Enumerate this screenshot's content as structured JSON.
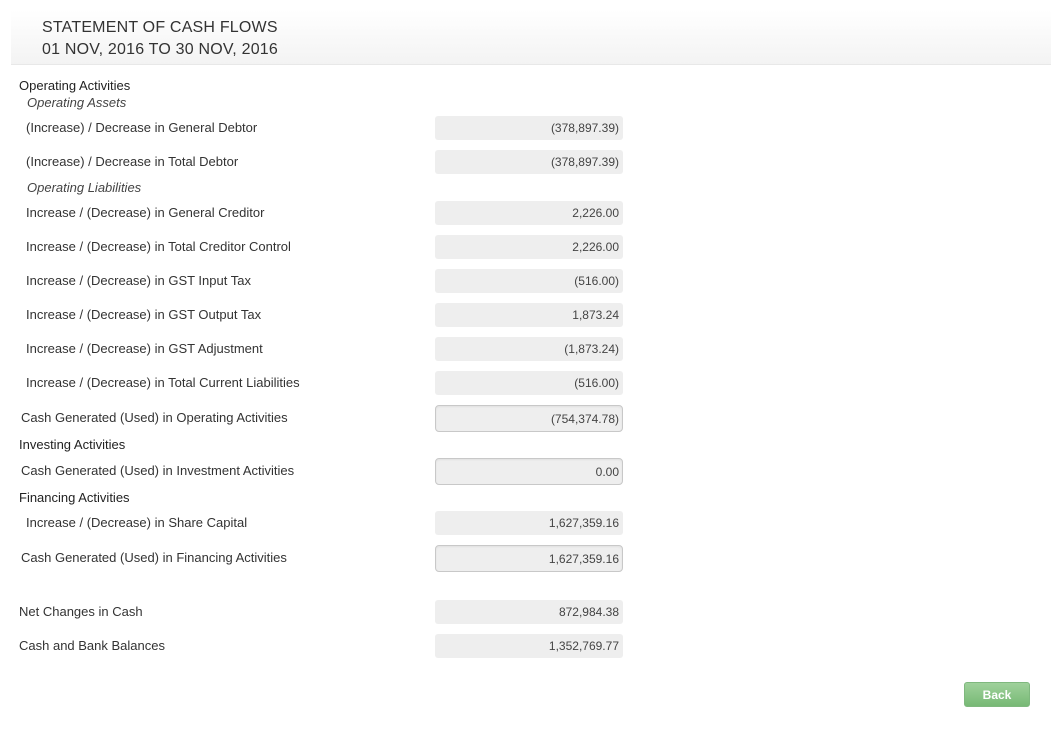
{
  "header": {
    "title": "STATEMENT OF CASH FLOWS",
    "period": "01 NOV, 2016 TO 30 NOV, 2016"
  },
  "operating": {
    "heading": "Operating Activities",
    "assets_heading": "Operating Assets",
    "general_debtor": {
      "label": "(Increase) / Decrease in General Debtor",
      "value": "(378,897.39)"
    },
    "total_debtor": {
      "label": "(Increase) / Decrease in Total Debtor",
      "value": "(378,897.39)"
    },
    "liabilities_heading": "Operating Liabilities",
    "general_creditor": {
      "label": "Increase / (Decrease) in General Creditor",
      "value": "2,226.00"
    },
    "total_creditor_control": {
      "label": "Increase / (Decrease) in Total Creditor Control",
      "value": "2,226.00"
    },
    "gst_input": {
      "label": "Increase / (Decrease) in GST Input Tax",
      "value": "(516.00)"
    },
    "gst_output": {
      "label": "Increase / (Decrease) in GST Output Tax",
      "value": "1,873.24"
    },
    "gst_adjustment": {
      "label": "Increase / (Decrease) in GST Adjustment",
      "value": "(1,873.24)"
    },
    "total_current_liabilities": {
      "label": "Increase / (Decrease) in Total Current Liabilities",
      "value": "(516.00)"
    },
    "cash_generated": {
      "label": "Cash Generated (Used) in Operating Activities",
      "value": "(754,374.78)"
    }
  },
  "investing": {
    "heading": "Investing Activities",
    "cash_generated": {
      "label": "Cash Generated (Used) in Investment Activities",
      "value": "0.00"
    }
  },
  "financing": {
    "heading": "Financing Activities",
    "share_capital": {
      "label": "Increase / (Decrease) in Share Capital",
      "value": "1,627,359.16"
    },
    "cash_generated": {
      "label": "Cash Generated (Used) in Financing Activities",
      "value": "1,627,359.16"
    }
  },
  "summary": {
    "net_changes": {
      "label": "Net Changes in Cash",
      "value": "872,984.38"
    },
    "cash_bank": {
      "label": "Cash and Bank Balances",
      "value": "1,352,769.77"
    }
  },
  "actions": {
    "back_label": "Back"
  },
  "colors": {
    "value_background": "#eeeeee",
    "back_button": "#77b975"
  }
}
